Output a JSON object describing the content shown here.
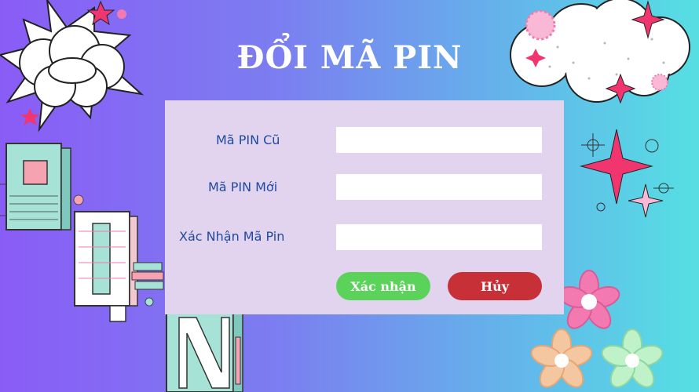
{
  "title": "ĐỔI MÃ PIN",
  "form": {
    "old_pin": {
      "label": "Mã PIN Cũ",
      "value": ""
    },
    "new_pin": {
      "label": "Mã PIN Mới",
      "value": ""
    },
    "confirm_pin": {
      "label": "Xác Nhận Mã Pin",
      "value": ""
    }
  },
  "buttons": {
    "confirm_label": "Xác nhận",
    "cancel_label": "Hủy"
  },
  "colors": {
    "background_start": "#8a5cf6",
    "background_end": "#56dfe3",
    "panel": "#e2d4ee",
    "label_text": "#1f4aa0",
    "confirm_button": "#5bd35a",
    "cancel_button": "#c63036",
    "sparkle": "#f0356f",
    "flower_pink": "#f37ab0",
    "flower_peach": "#f5c7a0",
    "flower_mint": "#bff2c8"
  },
  "decorations": {
    "letter_tiles": [
      "P",
      "I",
      "N"
    ]
  }
}
